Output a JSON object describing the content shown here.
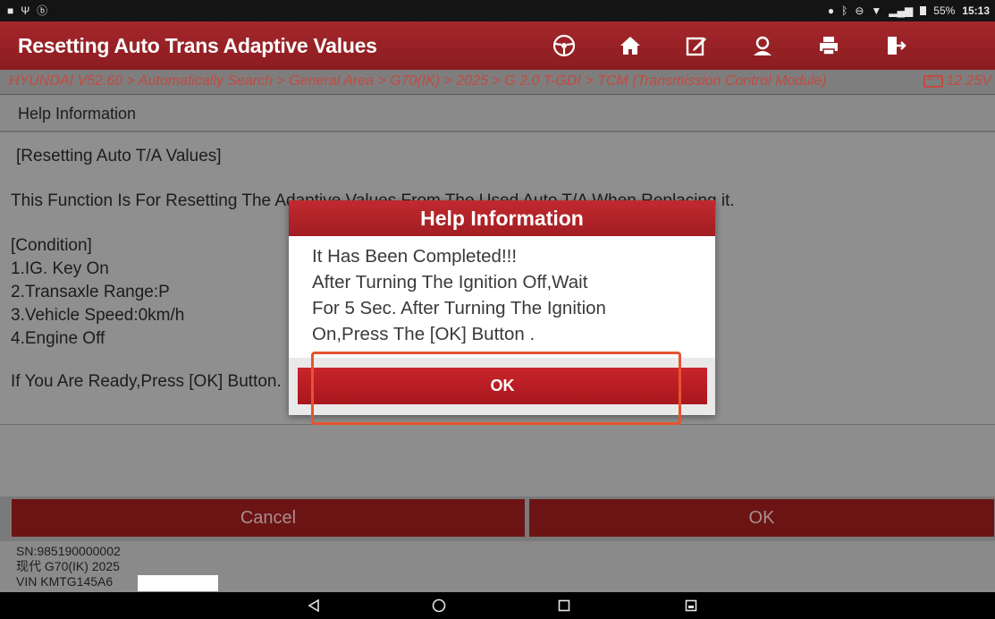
{
  "status_bar": {
    "left_icons": [
      "image-icon",
      "usb-icon",
      "bluetooth-icon"
    ],
    "right_icons": [
      "location-icon",
      "bluetooth-icon",
      "dnd-icon",
      "wifi-icon",
      "signal-icon"
    ],
    "battery": "55%",
    "time": "15:13"
  },
  "header": {
    "title": "Resetting Auto Trans Adaptive Values",
    "icons": [
      "steering-wheel-icon",
      "home-icon",
      "edit-report-icon",
      "user-icon",
      "print-icon",
      "exit-icon"
    ]
  },
  "breadcrumb": {
    "path": "HYUNDAI V52.60 > Automatically Search > General Area > G70(IK) > 2025 > G 2.0 T-GDI > TCM (Transmission Control Module)",
    "voltage": "12.25V"
  },
  "content": {
    "section_title": "Help Information",
    "lines": {
      "heading": "[Resetting Auto T/A Values]",
      "description": "This Function Is For Resetting The Adaptive Values From The Used Auto T/A When Replacing it.",
      "condition": "[Condition]",
      "c1": "1.IG. Key On",
      "c2": "2.Transaxle Range:P",
      "c3": "3.Vehicle Speed:0km/h",
      "c4": "4.Engine Off",
      "prompt": "If You Are Ready,Press [OK] Button."
    }
  },
  "buttons": {
    "cancel": "Cancel",
    "ok": "OK"
  },
  "footer": {
    "sn": "SN:985190000002",
    "model": "现代 G70(IK) 2025",
    "vin": "VIN KMTG145A6"
  },
  "dialog": {
    "title": "Help Information",
    "message_lines": [
      "It Has Been Completed!!!",
      "After Turning The Ignition Off,Wait",
      "For 5 Sec. After Turning The Ignition",
      "On,Press The [OK] Button ."
    ],
    "ok_label": "OK"
  },
  "colors": {
    "brand_red": "#a5272b",
    "dialog_button": "#c9252c",
    "breadcrumb_text": "#c34a41",
    "highlight": "#e7532f"
  },
  "nav": [
    "back-icon",
    "home-circle-icon",
    "recents-icon",
    "screenshot-icon"
  ]
}
